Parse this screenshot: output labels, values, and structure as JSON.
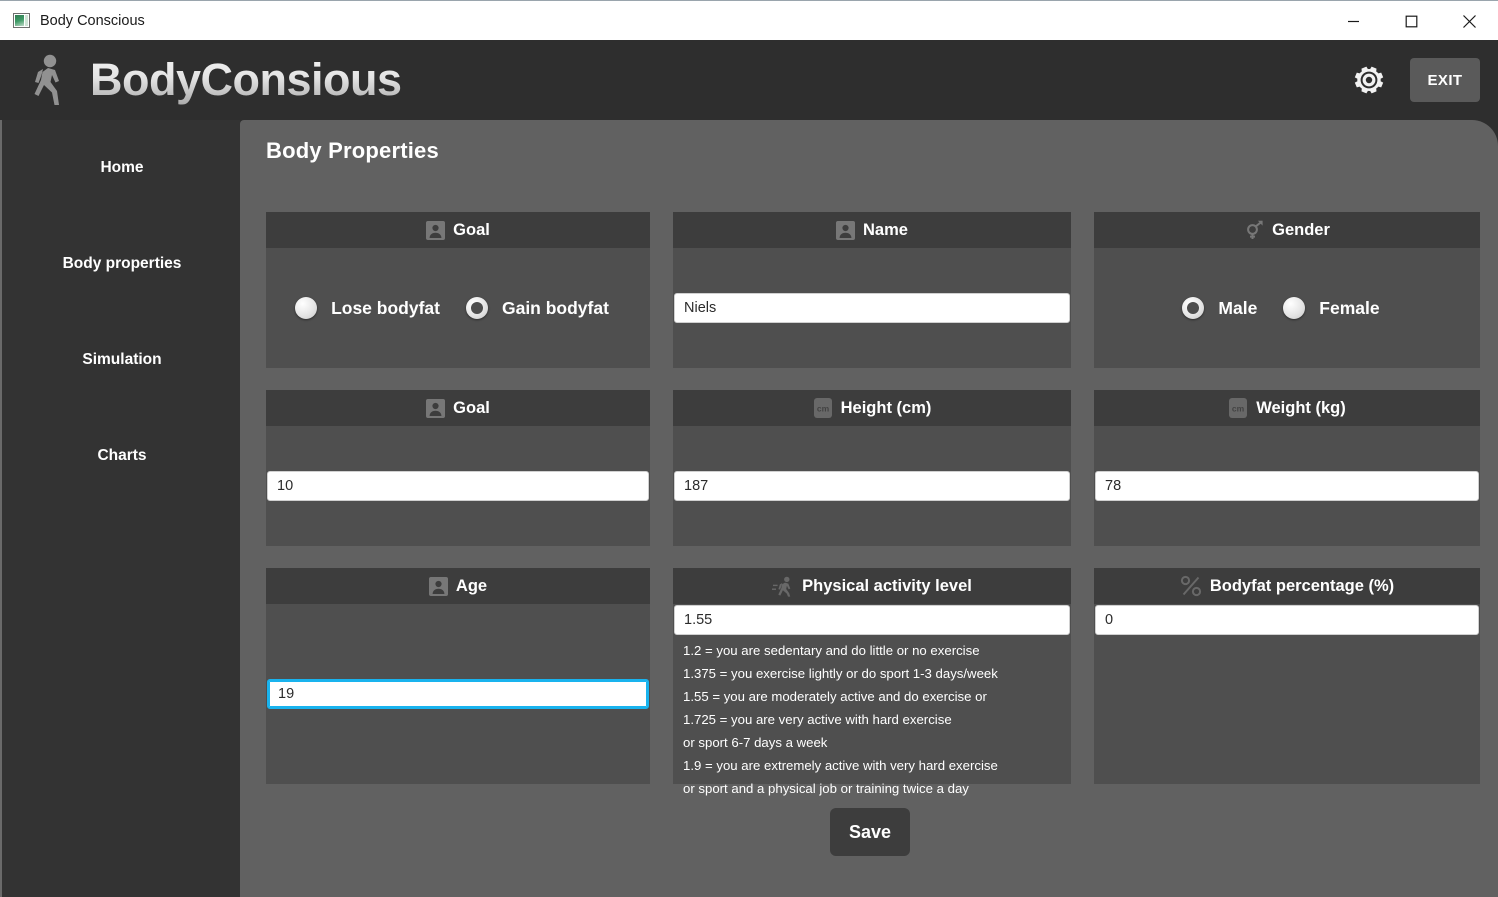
{
  "window": {
    "title": "Body Conscious",
    "app_icon": "app-window-icon",
    "controls": [
      {
        "name": "minimize",
        "glyph": "minimize-icon"
      },
      {
        "name": "maximize",
        "glyph": "maximize-icon"
      },
      {
        "name": "close",
        "glyph": "close-icon"
      }
    ]
  },
  "header": {
    "logo_icon": "walking-person-icon",
    "brand": "BodyConsious",
    "settings_icon": "gear-icon",
    "exit_label": "EXIT"
  },
  "sidebar": {
    "items": [
      {
        "label": "Home"
      },
      {
        "label": "Body properties"
      },
      {
        "label": "Simulation"
      },
      {
        "label": "Charts"
      }
    ]
  },
  "main": {
    "page_title": "Body Properties",
    "goal_radio": {
      "icon": "contact-card-icon",
      "title": "Goal",
      "options": [
        {
          "label": "Lose bodyfat",
          "checked": false
        },
        {
          "label": "Gain bodyfat",
          "checked": true
        }
      ]
    },
    "name": {
      "icon": "contact-card-icon",
      "title": "Name",
      "value": "Niels",
      "placeholder": ""
    },
    "gender": {
      "icon": "gender-symbol-icon",
      "title": "Gender",
      "options": [
        {
          "label": "Male",
          "checked": true
        },
        {
          "label": "Female",
          "checked": false
        }
      ]
    },
    "goal_value": {
      "icon": "contact-card-icon",
      "title": "Goal",
      "value": "10",
      "placeholder": ""
    },
    "height": {
      "icon": "cm-badge-icon",
      "icon_text": "cm",
      "title": "Height (cm)",
      "value": "187",
      "placeholder": ""
    },
    "weight": {
      "icon": "cm-badge-icon",
      "icon_text": "cm",
      "title": "Weight (kg)",
      "value": "78",
      "placeholder": ""
    },
    "age": {
      "icon": "contact-card-icon",
      "title": "Age",
      "value": "19",
      "placeholder": "",
      "focused": true
    },
    "physical_activity": {
      "icon": "running-person-icon",
      "title": "Physical activity level",
      "value": "1.55",
      "placeholder": "",
      "lines": [
        "1.2 = you are sedentary and do little or no exercise",
        "1.375 = you exercise lightly or do sport 1-3  days/week",
        "1.55 = you are moderately active and do exercise or",
        "1.725 = you are very active with hard exercise",
        " or sport 6-7 days a week",
        "1.9 = you are extremely active with very hard exercise",
        " or sport and a physical job or training twice a day"
      ]
    },
    "bodyfat": {
      "icon": "percent-icon",
      "icon_text": "%",
      "title": "Bodyfat percentage (%)",
      "value": "0",
      "placeholder": ""
    },
    "save_label": "Save"
  },
  "colors": {
    "window_chrome": "#2e2e2e",
    "sidebar": "#333333",
    "content": "#616161",
    "card": "#4f4f4f",
    "card_header": "#3d3d3d",
    "focus_accent": "#19b3ee",
    "titlebar": "#ffffff"
  }
}
